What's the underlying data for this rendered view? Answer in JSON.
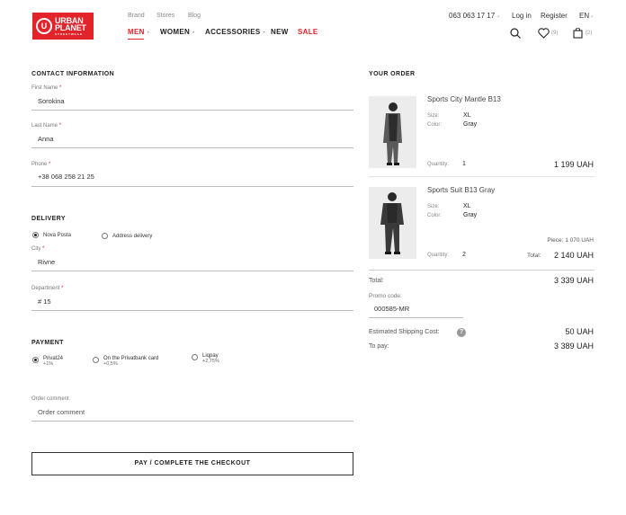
{
  "brand": {
    "logo_line1": "URBAN",
    "logo_line2": "PLANET",
    "logo_sub": "STREETWEAR"
  },
  "topnav": {
    "brand": "Brand",
    "stores": "Stores",
    "blog": "Blog"
  },
  "mainnav": {
    "men": "MEN",
    "women": "WOMEN",
    "accessories": "ACCESSORIES",
    "new": "NEW",
    "sale": "SALE"
  },
  "header": {
    "phone": "063 063 17 17",
    "login": "Log in",
    "register": "Register",
    "language": "EN"
  },
  "icons": {
    "wishlist_count": "(9)",
    "cart_count": "(2)"
  },
  "contact": {
    "title": "CONTACT INFORMATION",
    "first_name_label": "First Name",
    "first_name_value": "Sorokina",
    "last_name_label": "Last Name",
    "last_name_value": "Anna",
    "phone_label": "Phone",
    "phone_value": "+38 068 258 21 25"
  },
  "delivery": {
    "title": "DELIVERY",
    "option1": "Nova Posta",
    "option2": "Address delivery",
    "city_label": "City",
    "city_value": "Rivne",
    "department_label": "Department",
    "department_value": "# 15"
  },
  "payment": {
    "title": "PAYMENT",
    "opt1_label": "Privat24",
    "opt1_sub": "+1%",
    "opt2_label": "On the Privatbank card",
    "opt2_sub": "+0,5%",
    "opt3_label": "Liqpay",
    "opt3_sub": "+2,75%"
  },
  "comment": {
    "label": "Order comment",
    "value": "Order comment"
  },
  "pay_button": "PAY / COMPLETE THE CHECKOUT",
  "order": {
    "title": "YOUR ORDER",
    "size_label": "Size:",
    "color_label": "Color:",
    "quantity_label": "Quantity:",
    "items": [
      {
        "name": "Sports City Mantle B13",
        "size": "XL",
        "color": "Gray",
        "quantity": "1",
        "total": "1 199 UAH"
      },
      {
        "name": "Sports Suit B13 Gray",
        "size": "XL",
        "color": "Gray",
        "quantity": "2",
        "piece": "Piece: 1 070 UAH",
        "total_label": "Total:",
        "total": "2 140 UAH"
      }
    ],
    "total_label": "Total:",
    "total_value": "3 339 UAH",
    "promo_label": "Promo code:",
    "promo_value": "000585-MR",
    "shipping_label": "Estimated Shipping Cost:",
    "shipping_value": "50 UAH",
    "topay_label": "To pay:",
    "topay_value": "3 389 UAH"
  }
}
